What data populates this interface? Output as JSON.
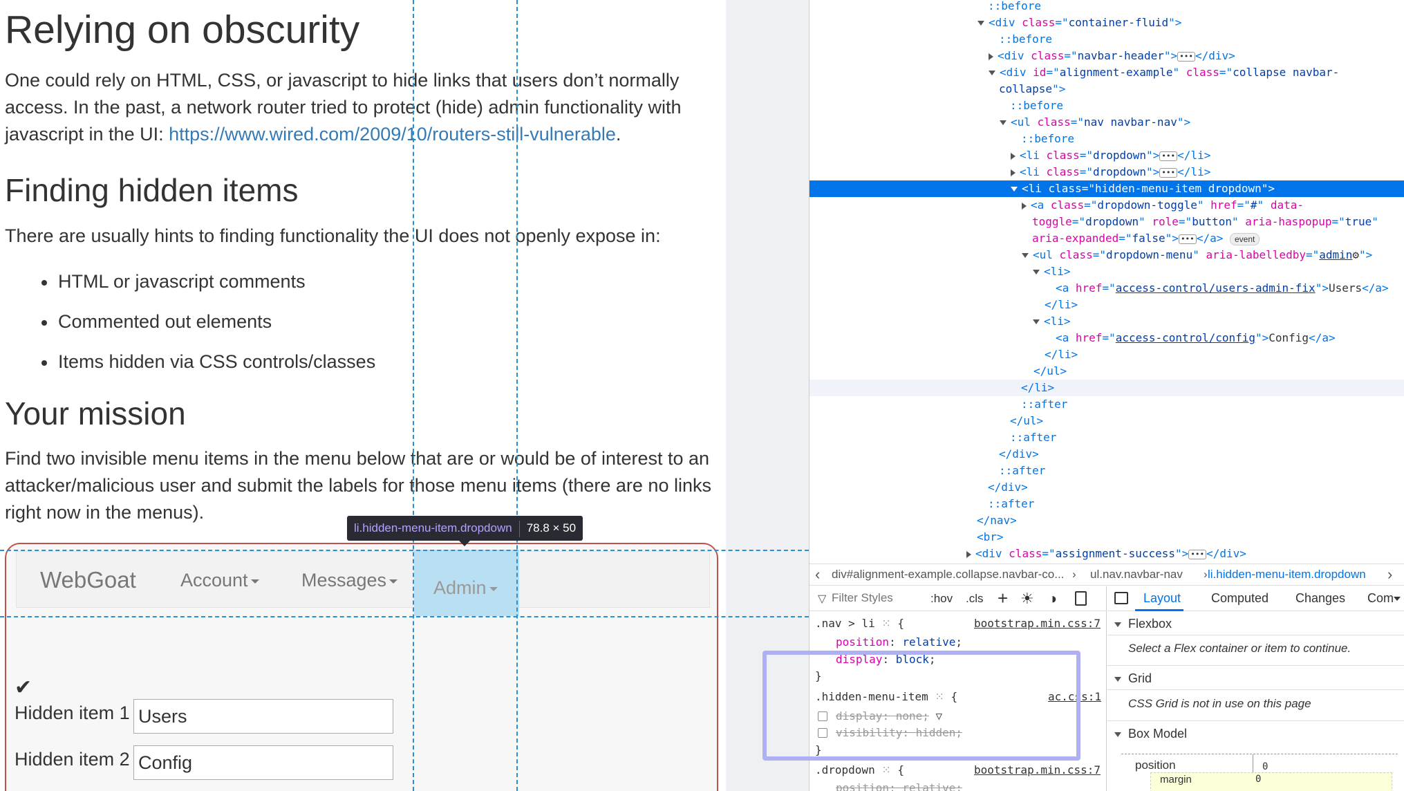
{
  "page": {
    "heading_obscurity": "Relying on obscurity",
    "para1_line1": "One could rely on HTML, CSS, or javascript to hide links that users don’t normally",
    "para1_line2": "access. In the past, a network router tried to protect (hide) admin functionality with",
    "para1_line3_prefix": "javascript in the UI: ",
    "para1_link": "https://www.wired.com/2009/10/routers-still-vulnerable",
    "para1_line3_suffix": ".",
    "heading_finding": "Finding hidden items",
    "para2": "There are usually hints to finding functionality the UI does not openly expose in:",
    "bullets": [
      "HTML or javascript comments",
      "Commented out elements",
      "Items hidden via CSS controls/classes"
    ],
    "heading_mission": "Your mission",
    "para3_line1": "Find two invisible menu items in the menu below that are or would be of interest to an",
    "para3_line2": "attacker/malicious user and submit the labels for those menu items (there are no links",
    "para3_line3": "right now in the menus)."
  },
  "navbar": {
    "brand": "WebGoat",
    "items": [
      "Account",
      "Messages",
      "Admin"
    ]
  },
  "form": {
    "check_glyph": "✔",
    "label1": "Hidden item 1",
    "value1": "Users",
    "label2": "Hidden item 2",
    "value2": "Config"
  },
  "tooltip": {
    "selector": "li.hidden-menu-item.dropdown",
    "size": "78.8 × 50"
  },
  "devtools": {
    "markup": {
      "l0": "::before",
      "l1_attr": "container-fluid",
      "l2": "::before",
      "l3_attr": "navbar-header",
      "l4_id": "alignment-example",
      "l4_class_a": "collapse navbar-",
      "l4_class_b": "collapse",
      "l5": "::before",
      "l6_class": "nav navbar-nav",
      "l7": "::before",
      "l8_class": "dropdown",
      "l9_class": "dropdown",
      "l10_class": "hidden-menu-item dropdown",
      "l11_class": "dropdown-toggle",
      "l11_href": "#",
      "l11_data_a": "data-",
      "l12_attr_toggle": "toggle",
      "l12_val_toggle": "dropdown",
      "l12_val_role": "button",
      "l12_val_haspopup": "true",
      "l13_val_expanded": "false",
      "event_badge": "event",
      "l14_class": "dropdown-menu",
      "l14_labelledby": "admin",
      "l17_href": "access-control/users-admin-fix",
      "l17_text": "Users",
      "l20_href": "access-control/config",
      "l20_text": "Config",
      "after": "::after",
      "l30_class": "assignment-success"
    },
    "breadcrumb": [
      "div#alignment-example.collapse.navbar-co...",
      "ul.nav.navbar-nav",
      "li.hidden-menu-item.dropdown"
    ],
    "rules_toolbar": {
      "filter_placeholder": "Filter Styles",
      "hov": ":hov",
      "cls": ".cls"
    },
    "rules": {
      "r1_selector": ".nav > li",
      "r1_source": "bootstrap.min.css:7",
      "r1_p1_name": "position",
      "r1_p1_value": "relative",
      "r1_p2_name": "display",
      "r1_p2_value": "block",
      "r2_selector": ".hidden-menu-item",
      "r2_source": "ac.css:1",
      "r2_p1_name": "display",
      "r2_p1_value": "none",
      "r2_p2_name": "visibility",
      "r2_p2_value": "hidden",
      "r3_selector": ".dropdown",
      "r3_source": "bootstrap.min.css:7",
      "r3_p1_partial": "position: relative;"
    },
    "layout_tabs": [
      "Layout",
      "Computed",
      "Changes",
      "Com"
    ],
    "layout": {
      "flexbox_title": "Flexbox",
      "flexbox_note": "Select a Flex container or item to continue.",
      "grid_title": "Grid",
      "grid_note": "CSS Grid is not in use on this page",
      "boxmodel_title": "Box Model",
      "bm_position": "position",
      "bm_position_value": "0",
      "bm_margin": "margin",
      "bm_margin_value": "0"
    }
  },
  "colors": {
    "accent": "#0074e8",
    "link": "#337ab7",
    "assignment_border": "#c0504d",
    "hover_highlight": "#b9dff2",
    "focus_box": "#aeb0f3"
  }
}
